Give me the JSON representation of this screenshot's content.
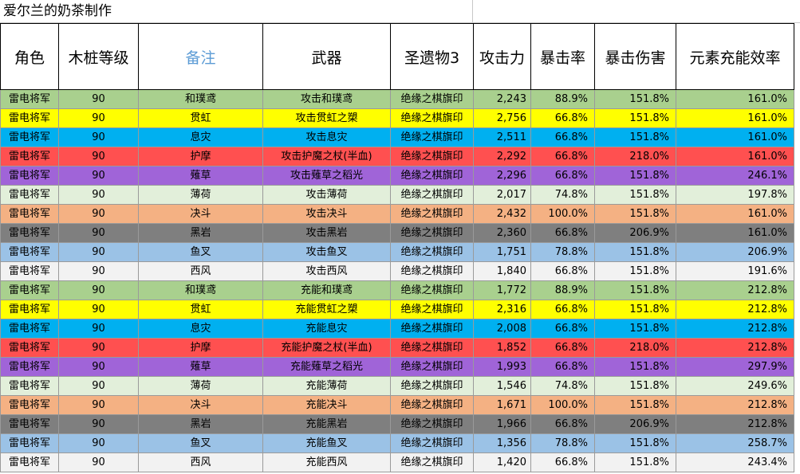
{
  "title": "爱尔兰的奶茶制作",
  "headers": [
    "角色",
    "木桩等级",
    "备注",
    "武器",
    "圣遗物3",
    "攻击力",
    "暴击率",
    "暴击伤害",
    "元素充能效率"
  ],
  "colors": {
    "green": "#a9d08e",
    "yellow": "#ffff00",
    "blue": "#00b0f0",
    "red": "#ff5050",
    "purple": "#a064d8",
    "lightgreen": "#e2efda",
    "orange": "#f4b183",
    "gray": "#7f7f7f",
    "lightblue": "#9bc2e6",
    "white": "#f2f2f2",
    "header_note": "#5b9bd5"
  },
  "rows": [
    {
      "role": "雷电将军",
      "level": "90",
      "note": "和璞鸢",
      "weapon": "攻击和璞鸢",
      "artifact": "绝缘之棋旗印",
      "atk": "2,243",
      "crit_rate": "88.9%",
      "crit_dmg": "151.8%",
      "er": "161.0%",
      "color": "green"
    },
    {
      "role": "雷电将军",
      "level": "90",
      "note": "贯虹",
      "weapon": "攻击贯虹之槊",
      "artifact": "绝缘之棋旗印",
      "atk": "2,756",
      "crit_rate": "66.8%",
      "crit_dmg": "151.8%",
      "er": "161.0%",
      "color": "yellow"
    },
    {
      "role": "雷电将军",
      "level": "90",
      "note": "息灾",
      "weapon": "攻击息灾",
      "artifact": "绝缘之棋旗印",
      "atk": "2,511",
      "crit_rate": "66.8%",
      "crit_dmg": "151.8%",
      "er": "161.0%",
      "color": "blue"
    },
    {
      "role": "雷电将军",
      "level": "90",
      "note": "护摩",
      "weapon": "攻击护魔之杖(半血)",
      "artifact": "绝缘之棋旗印",
      "atk": "2,292",
      "crit_rate": "66.8%",
      "crit_dmg": "218.0%",
      "er": "161.0%",
      "color": "red"
    },
    {
      "role": "雷电将军",
      "level": "90",
      "note": "薙草",
      "weapon": "攻击薙草之稻光",
      "artifact": "绝缘之棋旗印",
      "atk": "2,296",
      "crit_rate": "66.8%",
      "crit_dmg": "151.8%",
      "er": "246.1%",
      "color": "purple"
    },
    {
      "role": "雷电将军",
      "level": "90",
      "note": "薄荷",
      "weapon": "攻击薄荷",
      "artifact": "绝缘之棋旗印",
      "atk": "2,017",
      "crit_rate": "74.8%",
      "crit_dmg": "151.8%",
      "er": "197.8%",
      "color": "lightgreen"
    },
    {
      "role": "雷电将军",
      "level": "90",
      "note": "决斗",
      "weapon": "攻击决斗",
      "artifact": "绝缘之棋旗印",
      "atk": "2,432",
      "crit_rate": "100.0%",
      "crit_dmg": "151.8%",
      "er": "161.0%",
      "color": "orange"
    },
    {
      "role": "雷电将军",
      "level": "90",
      "note": "黑岩",
      "weapon": "攻击黑岩",
      "artifact": "绝缘之棋旗印",
      "atk": "2,360",
      "crit_rate": "66.8%",
      "crit_dmg": "206.9%",
      "er": "161.0%",
      "color": "gray"
    },
    {
      "role": "雷电将军",
      "level": "90",
      "note": "鱼叉",
      "weapon": "攻击鱼叉",
      "artifact": "绝缘之棋旗印",
      "atk": "1,751",
      "crit_rate": "78.8%",
      "crit_dmg": "151.8%",
      "er": "206.9%",
      "color": "lightblue"
    },
    {
      "role": "雷电将军",
      "level": "90",
      "note": "西风",
      "weapon": "攻击西风",
      "artifact": "绝缘之棋旗印",
      "atk": "1,840",
      "crit_rate": "66.8%",
      "crit_dmg": "151.8%",
      "er": "191.6%",
      "color": "white"
    },
    {
      "role": "雷电将军",
      "level": "90",
      "note": "和璞鸢",
      "weapon": "充能和璞鸢",
      "artifact": "绝缘之棋旗印",
      "atk": "1,772",
      "crit_rate": "88.9%",
      "crit_dmg": "151.8%",
      "er": "212.8%",
      "color": "green"
    },
    {
      "role": "雷电将军",
      "level": "90",
      "note": "贯虹",
      "weapon": "充能贯虹之槊",
      "artifact": "绝缘之棋旗印",
      "atk": "2,316",
      "crit_rate": "66.8%",
      "crit_dmg": "151.8%",
      "er": "212.8%",
      "color": "yellow"
    },
    {
      "role": "雷电将军",
      "level": "90",
      "note": "息灾",
      "weapon": "充能息灾",
      "artifact": "绝缘之棋旗印",
      "atk": "2,008",
      "crit_rate": "66.8%",
      "crit_dmg": "151.8%",
      "er": "212.8%",
      "color": "blue"
    },
    {
      "role": "雷电将军",
      "level": "90",
      "note": "护摩",
      "weapon": "充能护魔之杖(半血)",
      "artifact": "绝缘之棋旗印",
      "atk": "1,852",
      "crit_rate": "66.8%",
      "crit_dmg": "218.0%",
      "er": "212.8%",
      "color": "red"
    },
    {
      "role": "雷电将军",
      "level": "90",
      "note": "薙草",
      "weapon": "充能薙草之稻光",
      "artifact": "绝缘之棋旗印",
      "atk": "1,993",
      "crit_rate": "66.8%",
      "crit_dmg": "151.8%",
      "er": "297.9%",
      "color": "purple"
    },
    {
      "role": "雷电将军",
      "level": "90",
      "note": "薄荷",
      "weapon": "充能薄荷",
      "artifact": "绝缘之棋旗印",
      "atk": "1,546",
      "crit_rate": "74.8%",
      "crit_dmg": "151.8%",
      "er": "249.6%",
      "color": "lightgreen"
    },
    {
      "role": "雷电将军",
      "level": "90",
      "note": "决斗",
      "weapon": "充能决斗",
      "artifact": "绝缘之棋旗印",
      "atk": "1,671",
      "crit_rate": "100.0%",
      "crit_dmg": "151.8%",
      "er": "212.8%",
      "color": "orange"
    },
    {
      "role": "雷电将军",
      "level": "90",
      "note": "黑岩",
      "weapon": "充能黑岩",
      "artifact": "绝缘之棋旗印",
      "atk": "1,966",
      "crit_rate": "66.8%",
      "crit_dmg": "206.9%",
      "er": "212.8%",
      "color": "gray"
    },
    {
      "role": "雷电将军",
      "level": "90",
      "note": "鱼叉",
      "weapon": "充能鱼叉",
      "artifact": "绝缘之棋旗印",
      "atk": "1,356",
      "crit_rate": "78.8%",
      "crit_dmg": "151.8%",
      "er": "258.7%",
      "color": "lightblue"
    },
    {
      "role": "雷电将军",
      "level": "90",
      "note": "西风",
      "weapon": "充能西风",
      "artifact": "绝缘之棋旗印",
      "atk": "1,420",
      "crit_rate": "66.8%",
      "crit_dmg": "151.8%",
      "er": "243.4%",
      "color": "white"
    }
  ]
}
